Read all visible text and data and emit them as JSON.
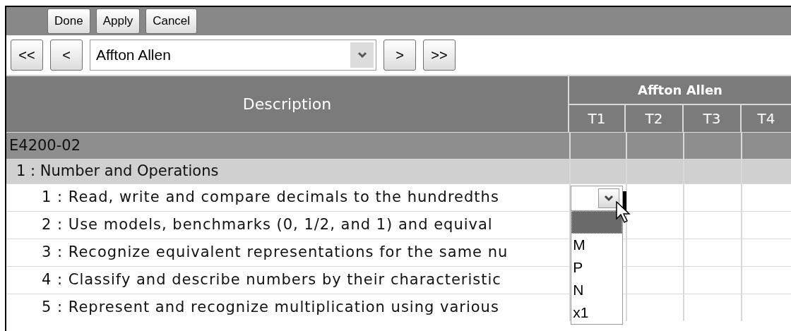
{
  "toolbar": {
    "buttons": [
      "Done",
      "Apply",
      "Cancel"
    ]
  },
  "navigator": {
    "first": "<<",
    "previous": "<",
    "student": "Affton Allen",
    "next": ">",
    "last": ">>"
  },
  "table": {
    "description_header": "Description",
    "student_header": "Affton Allen",
    "term_columns": [
      "T1",
      "T2",
      "T3",
      "T4"
    ],
    "rows": [
      {
        "kind": "group",
        "text": "E4200-02"
      },
      {
        "kind": "subgroup",
        "text": "1 : Number and Operations"
      },
      {
        "kind": "item",
        "text": "1 : Read, write and compare decimals to the hundredths",
        "t1_dropdown": {
          "options": [
            {
              "selected": true
            },
            {
              "label": "M",
              "selected": false
            },
            {
              "label": "P",
              "selected": false
            },
            {
              "label": "N",
              "selected": false
            },
            {
              "label": "x1",
              "selected": false
            }
          ]
        }
      },
      {
        "kind": "item",
        "text": "2 : Use models,  benchmarks (0, 1/2, and 1) and equival"
      },
      {
        "kind": "item",
        "text": "3 : Recognize equivalent representations for the same nu"
      },
      {
        "kind": "item",
        "text": "4 : Classify and describe numbers by their characteristic"
      },
      {
        "kind": "item",
        "text": "5 : Represent  and recognize multiplication using various"
      }
    ]
  }
}
